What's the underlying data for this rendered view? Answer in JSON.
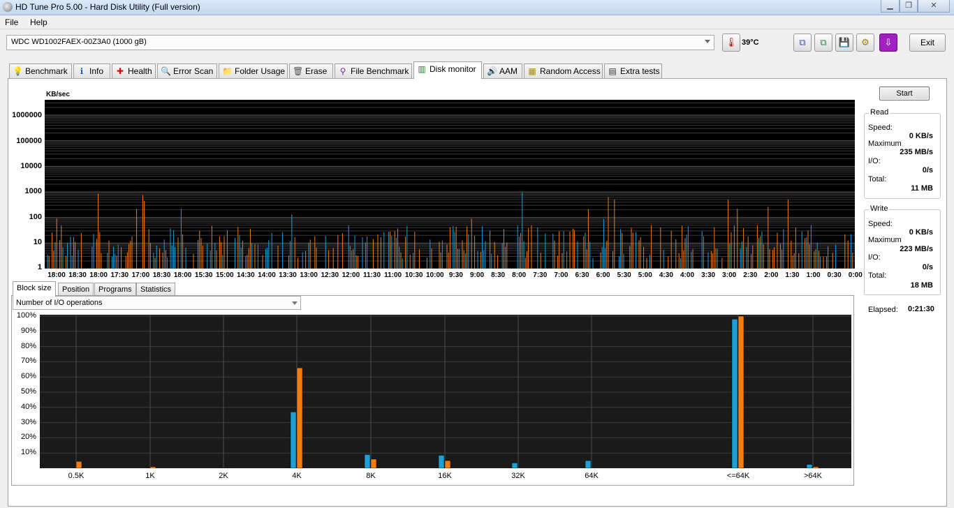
{
  "window": {
    "title": "HD Tune Pro 5.00 - Hard Disk Utility (Full version)"
  },
  "menu": {
    "file": "File",
    "help": "Help"
  },
  "toolbar": {
    "drive": "WDC WD1002FAEX-00Z3A0 (1000 gB)",
    "temperature": "39°C",
    "exit": "Exit"
  },
  "tabs": [
    "Benchmark",
    "Info",
    "Health",
    "Error Scan",
    "Folder Usage",
    "Erase",
    "File Benchmark",
    "Disk monitor",
    "AAM",
    "Random Access",
    "Extra tests"
  ],
  "active_tab": "Disk monitor",
  "monitor": {
    "unit": "KB/sec",
    "y_ticks": [
      "1000000",
      "100000",
      "10000",
      "1000",
      "100",
      "10",
      "1"
    ],
    "x_ticks": [
      "18:00",
      "18:30",
      "18:00",
      "17:30",
      "17:00",
      "18:30",
      "18:00",
      "15:30",
      "15:00",
      "14:30",
      "14:00",
      "13:30",
      "13:00",
      "12:30",
      "12:00",
      "11:30",
      "11:00",
      "10:30",
      "10:00",
      "9:30",
      "9:00",
      "8:30",
      "8:00",
      "7:30",
      "7:00",
      "6:30",
      "6:00",
      "5:30",
      "5:00",
      "4:30",
      "4:00",
      "3:30",
      "3:00",
      "2:30",
      "2:00",
      "1:30",
      "1:00",
      "0:30",
      "0:00"
    ],
    "colors": {
      "read": "#1e9fd6",
      "write": "#f07d14",
      "background": "#000000"
    }
  },
  "start_button": "Start",
  "read": {
    "title": "Read",
    "speed_label": "Speed:",
    "speed": "0 KB/s",
    "max_label": "Maximum",
    "max": "235 MB/s",
    "io_label": "I/O:",
    "io": "0/s",
    "total_label": "Total:",
    "total": "11 MB"
  },
  "write": {
    "title": "Write",
    "speed_label": "Speed:",
    "speed": "0 KB/s",
    "max_label": "Maximum",
    "max": "223 MB/s",
    "io_label": "I/O:",
    "io": "0/s",
    "total_label": "Total:",
    "total": "18 MB"
  },
  "elapsed": {
    "label": "Elapsed:",
    "value": "0:21:30"
  },
  "subtabs": [
    "Block size",
    "Position",
    "Programs",
    "Statistics"
  ],
  "combo_value": "Number of I/O operations",
  "chart_data": {
    "type": "bar",
    "categories": [
      "0.5K",
      "1K",
      "2K",
      "4K",
      "8K",
      "16K",
      "32K",
      "64K",
      "<=64K",
      ">64K"
    ],
    "series": [
      {
        "values": [
          0,
          0,
          0,
          37,
          9,
          8.5,
          3.5,
          5,
          98,
          2.5
        ]
      },
      {
        "values": [
          4.5,
          1,
          0.3,
          66,
          6,
          5,
          0,
          0,
          100,
          1
        ]
      }
    ],
    "y_ticks": [
      "100%",
      "90%",
      "80%",
      "70%",
      "60%",
      "50%",
      "40%",
      "30%",
      "20%",
      "10%"
    ],
    "ylim": [
      0,
      100
    ],
    "grid": true
  }
}
